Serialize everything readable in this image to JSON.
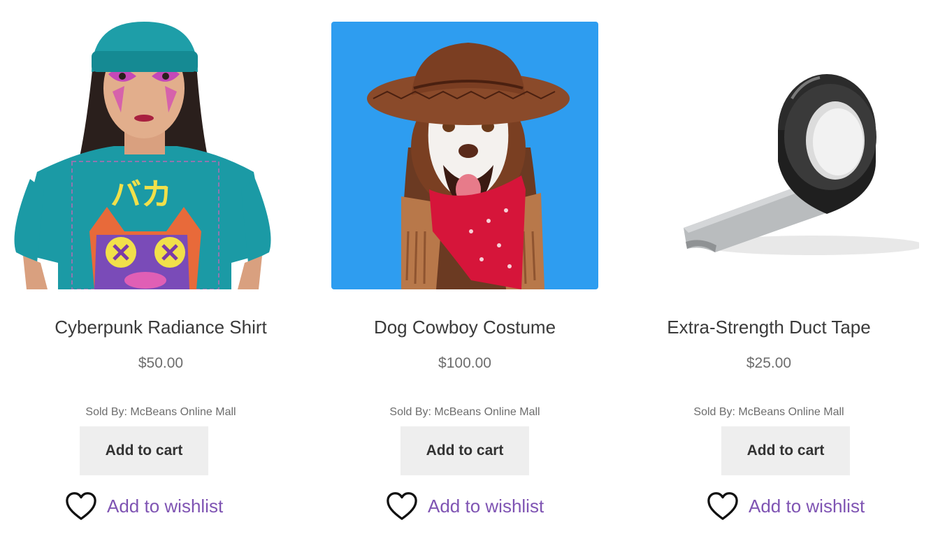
{
  "products": [
    {
      "title": "Cyberpunk Radiance Shirt",
      "price": "$50.00",
      "sold_by": "Sold By: McBeans Online Mall",
      "add_to_cart_label": "Add to cart",
      "wishlist_label": "Add to wishlist",
      "wishlist_icon": "heart-outline-icon",
      "image": "woman in teal beanie and teal t-shirt with cyberpunk cat graphic"
    },
    {
      "title": "Dog Cowboy Costume",
      "price": "$100.00",
      "sold_by": "Sold By: McBeans Online Mall",
      "add_to_cart_label": "Add to cart",
      "wishlist_label": "Add to wishlist",
      "wishlist_icon": "heart-outline-icon",
      "image": "husky dog wearing brown cowboy hat, fringe vest and red bandana on blue background"
    },
    {
      "title": "Extra-Strength Duct Tape",
      "price": "$25.00",
      "sold_by": "Sold By: McBeans Online Mall",
      "add_to_cart_label": "Add to cart",
      "wishlist_label": "Add to wishlist",
      "wishlist_icon": "heart-outline-icon",
      "image": "roll of black duct tape with unrolled silver strip"
    }
  ],
  "colors": {
    "wishlist_link": "#7f54b3",
    "button_bg": "#eeeeee",
    "title_text": "#3a3a3a",
    "muted_text": "#6d6d6d",
    "dog_background": "#2e9df0"
  }
}
